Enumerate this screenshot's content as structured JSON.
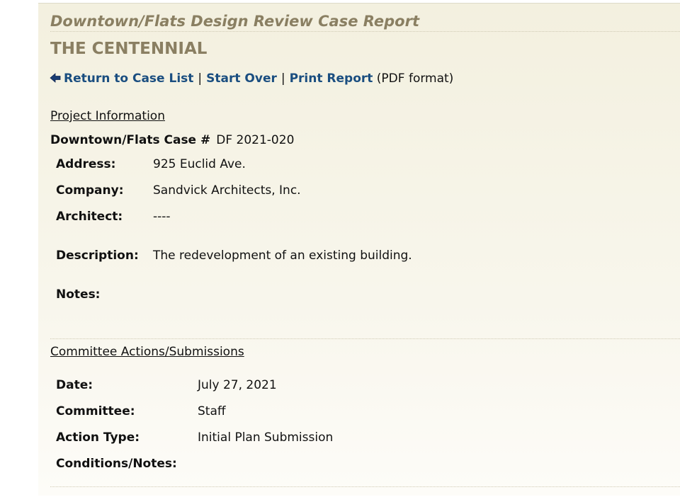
{
  "report": {
    "title": "Downtown/Flats Design Review Case Report",
    "project_name": "THE CENTENNIAL"
  },
  "nav": {
    "back_icon": "left-arrow-icon",
    "return_label": "Return to Case List",
    "separator": "|",
    "start_over_label": "Start Over",
    "print_label": "Print Report",
    "print_suffix": "(PDF format)"
  },
  "project_info": {
    "section_title": "Project Information",
    "case_label": "Downtown/Flats Case #",
    "case_number": "DF 2021-020",
    "fields": [
      {
        "label": "Address:",
        "value": "925 Euclid Ave."
      },
      {
        "label": "Company:",
        "value": "Sandvick Architects, Inc."
      },
      {
        "label": "Architect:",
        "value": "----"
      },
      {
        "label": "Description:",
        "value": "The redevelopment of an existing building."
      },
      {
        "label": "Notes:",
        "value": ""
      }
    ]
  },
  "committee_actions": {
    "section_title": "Committee Actions/Submissions",
    "fields": [
      {
        "label": "Date:",
        "value": "July 27, 2021"
      },
      {
        "label": "Committee:",
        "value": "Staff"
      },
      {
        "label": "Action Type:",
        "value": "Initial Plan Submission"
      },
      {
        "label": "Conditions/Notes:",
        "value": ""
      }
    ]
  },
  "colors": {
    "heading": "#8a7f62",
    "link": "#1a4e80",
    "background": "#f3f0df"
  }
}
